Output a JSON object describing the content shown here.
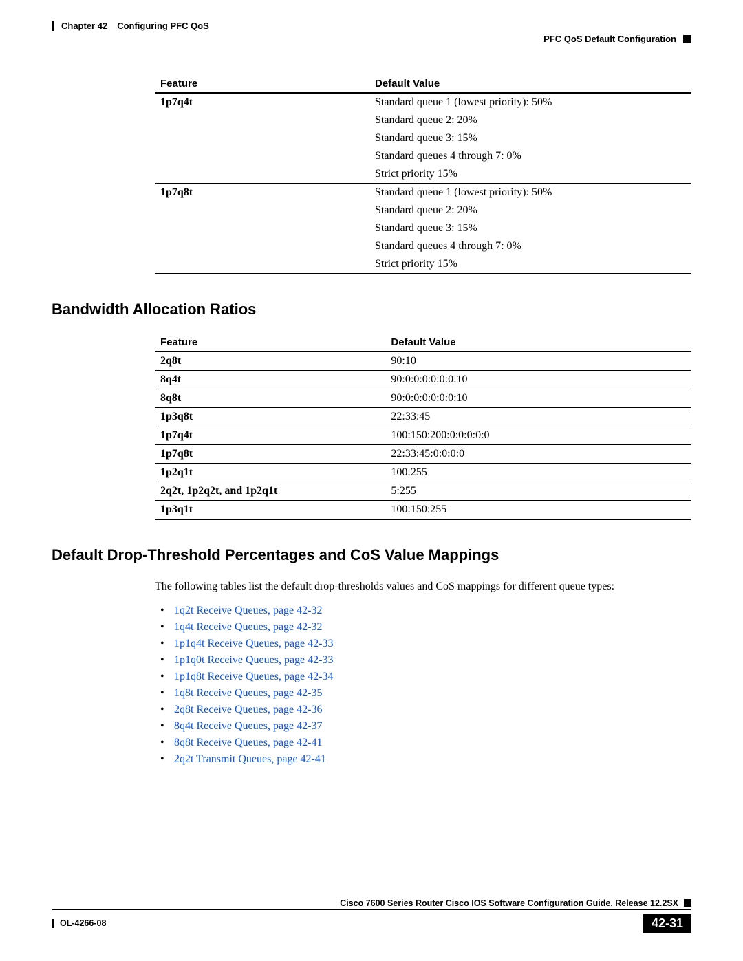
{
  "header": {
    "chapter": "Chapter 42",
    "title": "Configuring PFC QoS",
    "section": "PFC QoS Default Configuration"
  },
  "table1": {
    "head_feature": "Feature",
    "head_value": "Default Value",
    "rows": [
      {
        "feature": "1p7q4t",
        "values": [
          "Standard queue 1 (lowest priority): 50%",
          "Standard queue 2: 20%",
          "Standard queue 3: 15%",
          "Standard queues 4 through 7: 0%",
          "Strict priority 15%"
        ]
      },
      {
        "feature": "1p7q8t",
        "values": [
          "Standard queue 1 (lowest priority): 50%",
          "Standard queue 2: 20%",
          "Standard queue 3: 15%",
          "Standard queues 4 through 7: 0%",
          "Strict priority 15%"
        ]
      }
    ]
  },
  "section_bandwidth": "Bandwidth Allocation Ratios",
  "table2": {
    "head_feature": "Feature",
    "head_value": "Default Value",
    "rows": [
      {
        "feature": "2q8t",
        "value": "90:10"
      },
      {
        "feature": "8q4t",
        "value": "90:0:0:0:0:0:0:10"
      },
      {
        "feature": "8q8t",
        "value": "90:0:0:0:0:0:0:10"
      },
      {
        "feature": "1p3q8t",
        "value": "22:33:45"
      },
      {
        "feature": "1p7q4t",
        "value": "100:150:200:0:0:0:0:0"
      },
      {
        "feature": "1p7q8t",
        "value": "22:33:45:0:0:0:0"
      },
      {
        "feature": "1p2q1t",
        "value": "100:255"
      },
      {
        "feature_html": "<b>2q2t</b>, <b>1p2q2t</b>, and <b>1p2q1t</b>",
        "value": "5:255"
      },
      {
        "feature": "1p3q1t",
        "value": "100:150:255"
      }
    ]
  },
  "section_drop": "Default Drop-Threshold Percentages and CoS Value Mappings",
  "intro_para": "The following tables list the default drop-thresholds values and CoS mappings for different queue types:",
  "links": [
    "1q2t Receive Queues, page 42-32",
    "1q4t Receive Queues, page 42-32",
    "1p1q4t Receive Queues, page 42-33",
    "1p1q0t Receive Queues, page 42-33",
    "1p1q8t Receive Queues, page 42-34",
    "1q8t Receive Queues, page 42-35",
    "2q8t Receive Queues, page 42-36",
    "8q4t Receive Queues, page 42-37",
    "8q8t Receive Queues, page 42-41",
    "2q2t Transmit Queues, page 42-41"
  ],
  "footer": {
    "guide": "Cisco 7600 Series Router Cisco IOS Software Configuration Guide, Release 12.2SX",
    "docnum": "OL-4266-08",
    "page": "42-31"
  }
}
